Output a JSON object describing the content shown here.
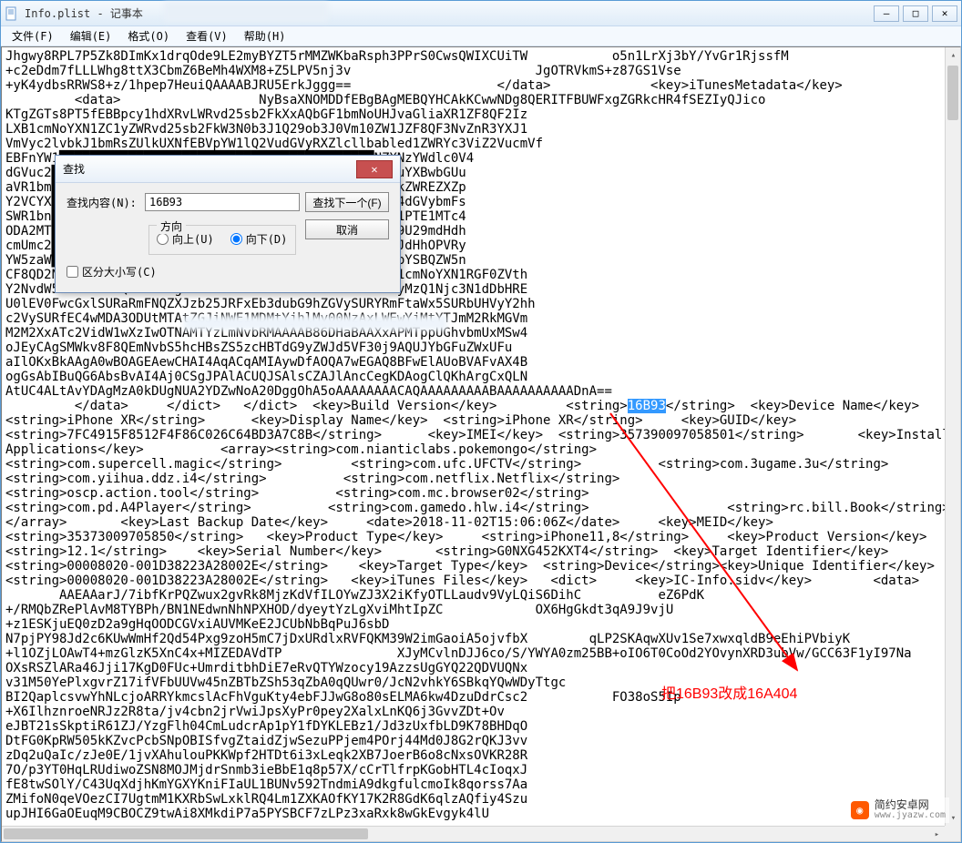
{
  "window": {
    "title": "Info.plist - 记事本",
    "min": "—",
    "max": "□",
    "close": "✕"
  },
  "menu": {
    "file": "文件(F)",
    "edit": "编辑(E)",
    "format": "格式(O)",
    "view": "查看(V)",
    "help": "帮助(H)"
  },
  "dialog": {
    "title": "查找",
    "label": "查找内容(N):",
    "value": "16B93",
    "findnext": "查找下一个(F)",
    "cancel": "取消",
    "direction": "方向",
    "up": "向上(U)",
    "down": "向下(D)",
    "matchcase": "区分大小写(C)"
  },
  "content": {
    "lines": [
      "Jhgwy8RPL7P5Zk8DImKx1drqOde9LE2myBYZT5rMMZWKbaRsph3PPrS0CwsQWIXCUiTW           o5n1LrXj3bY/YvGr1RjssfM",
      "+c2eDdm7fLLLWhg8ttX3CbmZ6BeMh4WXM8+Z5LPV5nj3v                        JgOTRVkmS+z87GS1Vse",
      "+yK4ydbsRRWS8+z/1hpep7HeuiQAAAABJRU5ErkJggg==                   </data>             <key>iTunesMetadata</key>",
      "         <data>                  NyBsaXNOMDDfEBgBAgMEBQYHCAkKCwwNDg8QERITFBUWFxgZGRkcHR4fSEZIyQJico",
      "KTgZGTs8PT5fEBBpcy1hdXRvLWRvd25sb2FkXxAQbGF1bmNoUHJvaGliaXR1ZF8QF2Iz",
      "LXB1cmNoYXN1ZC1yZWRvd25sb2FkW3N0b3J1Q29ob3J0Vm10ZW1JZF8QF3NvZnR3YXJ1",
      "VmVyc2lvbkJ1bmRsZUlkUXNfEBVpYW1lQ2VudGVyRXZlcllbabled1ZWRYc3ViZ2VucmVf",
      "EBFnYW1█████████████████████████████████████████NZXNzYWdlc0V4",
      "dGVuc2█████████████████████████████████████████jb20uYXBwbGUu",
      "aVR1bm█████████████████████████████████████████Mb2FkZWREZXZp",
      "Y2VCYX█████████████████████████████████████████vbkV4dGVybmFs",
      "SWR1bn█████████████████████████████████████████kYXR1PTE1MTc4",
      "ODA2MT█████████████████████████████████████████ndhA9U29mdHdh",
      "cmUmc2█████████████████████████████████████████OMCZJdHhOPVRy",
      "YW5zaW█████████████████████████████████████████lWFhpYSBQZW5n",
      "CF8QD2Nvc3QgY1Mgc2ltcGx1lhEXclgyMDE4MDYwNNIqKywtXHB1cmNoYXN1RGF0ZVth",
      "Y2NvdW50SW5mb18QFDIwMTgtMDItMDZUMDE6NTU6MThali4vMDEyMzQ1Njc3N1dDbHRE",
      "U0lEV0FwcGxlSURaRmFNQZXJzb25JRFxEb3dubG9hZGVySURYRmFtaWx5SURbUHVyY2hh",
      "c2VySURfEC4wMDA3ODUtMTAtZGJiNWE1MDMtYjhlMy00NzAxLWEwYjMtYTJmM2RkMGVm",
      "M2M2XxATc2VidW1wXzIwOTNAMTYzLmNvbRMAAAAB86DHaBAAXxAPMTppUGhvbmUxMSw4",
      "oJEyCAgSMWkv8F8QEmNvbS5hcHBsZS5zcHBTdG9yZWJd5VF30j9AQUJYbGFuZWxUFu",
      "aIlOKxBkAAgA0wBOAGEAewCHAI4AqACqAMIAywDfAOQA7wEGAQ8BFwElAUoBVAFvAX4B",
      "ogGsAbIBuQG6AbsBvAI4Aj0CSgJPAlACUQJSAlsCZAJlAncCegKDAogClQKhArgCxQLN",
      "AtUC4ALtAvYDAgMzA0kDUgNUA2YDZwNoA20DggOhA5oAAAAAAAACAQAAAAAAAAABAAAAAAAAAADnA==",
      "         </data>     </dict>   </dict>  <key>Build Version</key>         <string>16B93</string>  <key>Device Name</key>",
      "<string>iPhone XR</string>      <key>Display Name</key>  <string>iPhone XR</string>     <key>GUID</key>",
      "<string>7FC4915F8512F4F86C026C64BD3A7C8B</string>      <key>IMEI</key>  <string>357390097058501</string>       <key>Installed",
      "Applications</key>          <array><string>com.nianticlabs.pokemongo</string>",
      "<string>com.supercell.magic</string>         <string>com.ufc.UFCTV</string>          <string>com.3ugame.3u</string>",
      "<string>com.yiihua.ddz.i4</string>          <string>com.netflix.Netflix</string>",
      "<string>oscp.action.tool</string>          <string>com.mc.browser02</string>",
      "<string>com.pd.A4Player</string>          <string>com.gamedo.hlw.i4</string>                  <string>rc.bill.Book</string>",
      "</array>       <key>Last Backup Date</key>     <date>2018-11-02T15:06:06Z</date>     <key>MEID</key>",
      "<string>35373009705850</string>   <key>Product Type</key>     <string>iPhone11,8</string>     <key>Product Version</key>",
      "<string>12.1</string>    <key>Serial Number</key>       <string>G0NXG452KXT4</string>  <key>Target Identifier</key>",
      "<string>00008020-001D38223A28002E</string>    <key>Target Type</key>  <string>Device</string><key>Unique Identifier</key>",
      "<string>00008020-001D38223A28002E</string>   <key>iTunes Files</key>   <dict>     <key>IC-Info.sidv</key>        <data>",
      "       AAEAAarJ/7ibfKrPQZwux2gvRk8MjzKdVfILOYwZJ3X2iKfyOTLLaudv9VyLQiS6DihC          eZ6PdK",
      "+/RMQbZRePlAvM8TYBPh/BN1NEdwnNhNPXHOD/dyeytYzLgXviMhtIpZC            OX6HgGkdt3qA9J9vjU",
      "+z1ESKjuEQ0zD2a9gHqOODCGVxiAUVMKeE2JCUbNbBqPuJ6sbD",
      "N7pjPY98Jd2c6KUwWmHf2Qd54Pxg9zoH5mC7jDxURdlxRVFQKM39W2imGaoiA5ojvfbX        qLP2SKAqwXUv1Se7xwxqldB9eEhiPVbiyK",
      "+l1OZjLOAwT4+mzGlzK5XnC4x+MIZEDAVdTP               XJyMCvlnDJJ6co/S/YWYA0zm25BB+oIO6T0CoOd2YOvynXRD3ubVw/GCC63F1yI97Na",
      "OXsRSZlARa46Jji17KgD0FUc+UmrditbhDiE7eRvQTYWzocy19AzzsUgGYQ22QDVUQNx",
      "v31M50YePlxgvrZ17ifVFbUUVw45nZBTbZSh53qZbA0qQUwr0/JcN2vhkY6SBkqYQwWDyTtgc",
      "BI2QaplcsvwYhNLcjoARRYkmcslAcFhVguKty4ebFJJwG8o80sELMA6kw4DzuDdrCsc2           FO38oS5Ip",
      "+X6IlhznroeNRJz2R8ta/jv4cbn2jrVwiJpsXyPr0pey2XalxLnKQ6j3GvvZDt+Ov",
      "eJBT21sSkptiR61ZJ/YzgFlh04CmLudcrAp1pY1fDYKLEBz1/Jd3zUxfbLD9K78BHDqO",
      "DtFG0KpRW505kKZvcPcbSNpOBISfvgZtaidZjwSezuPPjem4POrj44Md0J8G2rQKJ3vv",
      "zDq2uQaIc/zJe0E/1jvXAhulouPKKWpf2HTDt6i3xLeqk2XB7JoerB6o8cNxsOVKR28R",
      "7O/p3YT0HqLRUdiwoZSN8MOJMjdrSnmb3ieBbE1q8p57X/cCrTlfrpKGobHTL4cIoqxJ",
      "fE8twSOlY/C43UqXdjhKmYGXYKniFIaUL1BUNv592TndmiA9dkgfulcmoIk8qorss7Aa",
      "ZMifoN0qeVOezCI7UgtmM1KXRbSwLxklRQ4Lm1ZXKAOfKY17K2R8GdK6qlzAQfiy4Szu",
      "upJHI6GaOEuqM9CBOCZ9twAi8XMkdiP7a5PYSBCF7zLPz3xaRxk8wGkEvgyk4lU"
    ],
    "highlight_line_index": 24,
    "highlight_text": "16B93"
  },
  "annotation": "把16B93改成16A404",
  "watermark": {
    "name": "简约安卓网",
    "url": "www.jyazw.com"
  }
}
